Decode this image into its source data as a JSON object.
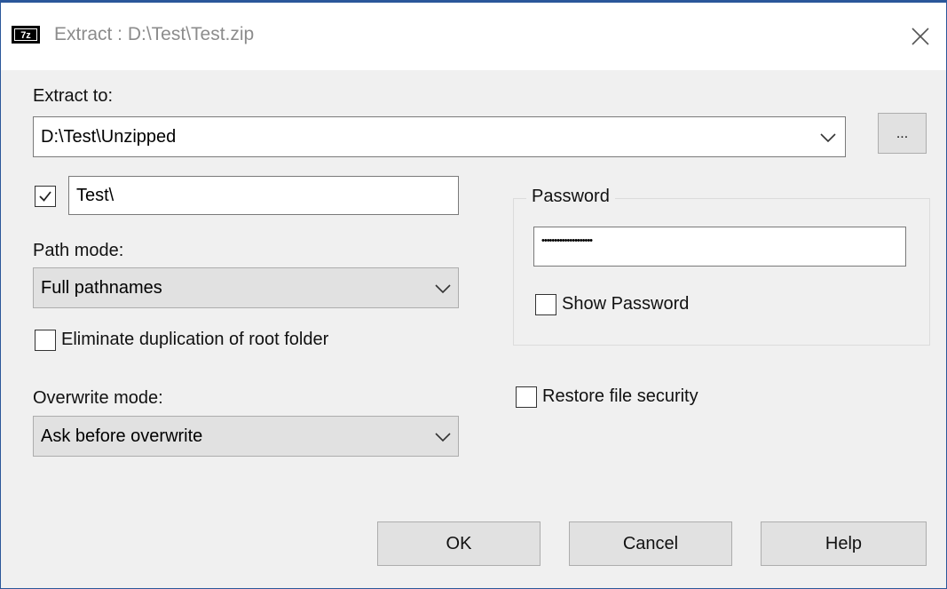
{
  "window": {
    "title": "Extract : D:\\Test\\Test.zip",
    "icon_text": "7z"
  },
  "extract_to": {
    "label": "Extract to:",
    "value": "D:\\Test\\Unzipped",
    "browse_label": "..."
  },
  "subfolder": {
    "checked": true,
    "value": "Test\\"
  },
  "path_mode": {
    "label": "Path mode:",
    "selected": "Full pathnames"
  },
  "eliminate_duplication": {
    "label": "Eliminate duplication of root folder",
    "checked": false
  },
  "overwrite_mode": {
    "label": "Overwrite mode:",
    "selected": "Ask before overwrite"
  },
  "password": {
    "group_label": "Password",
    "value": "••••••••••••••••••••",
    "show_label": "Show Password",
    "show_checked": false
  },
  "restore_security": {
    "label": "Restore file security",
    "checked": false
  },
  "buttons": {
    "ok": "OK",
    "cancel": "Cancel",
    "help": "Help"
  },
  "colors": {
    "border_accent": "#2b579a",
    "dialog_bg": "#f0f0f0",
    "button_bg": "#e1e1e1"
  }
}
